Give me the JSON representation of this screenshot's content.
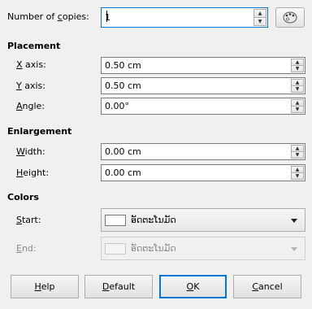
{
  "copies": {
    "label_pre": "Number of ",
    "label_mnemonic": "c",
    "label_post": "opies:",
    "value": "1"
  },
  "placement": {
    "title": "Placement",
    "x_axis": {
      "mnemonic": "X",
      "rest": " axis:",
      "value": "0.50 cm"
    },
    "y_axis": {
      "mnemonic": "Y",
      "rest": " axis:",
      "value": "0.50 cm"
    },
    "angle": {
      "mnemonic": "A",
      "rest": "ngle:",
      "value": "0.00°"
    }
  },
  "enlargement": {
    "title": "Enlargement",
    "width": {
      "mnemonic": "W",
      "rest": "idth:",
      "value": "0.00 cm"
    },
    "height": {
      "mnemonic": "H",
      "rest": "eight:",
      "value": "0.00 cm"
    }
  },
  "colors": {
    "title": "Colors",
    "start": {
      "mnemonic": "S",
      "rest": "tart:",
      "value": "ອັດຕະໂນມັດ"
    },
    "end": {
      "mnemonic": "E",
      "rest": "nd:",
      "value": "ອັດຕະໂນມັດ"
    },
    "swatch_color": "#ffffff"
  },
  "buttons": {
    "help": {
      "mnemonic": "H",
      "rest": "elp"
    },
    "default": {
      "mnemonic": "D",
      "rest": "efault"
    },
    "ok": {
      "mnemonic": "O",
      "rest": "K"
    },
    "cancel": {
      "mnemonic": "C",
      "rest": "ancel"
    }
  },
  "icons": {
    "color_picker": "palette-icon",
    "spin_up": "spin-up-arrow-icon",
    "spin_down": "spin-down-arrow-icon",
    "dropdown": "dropdown-arrow-icon"
  },
  "accent_color": "#0078d7"
}
